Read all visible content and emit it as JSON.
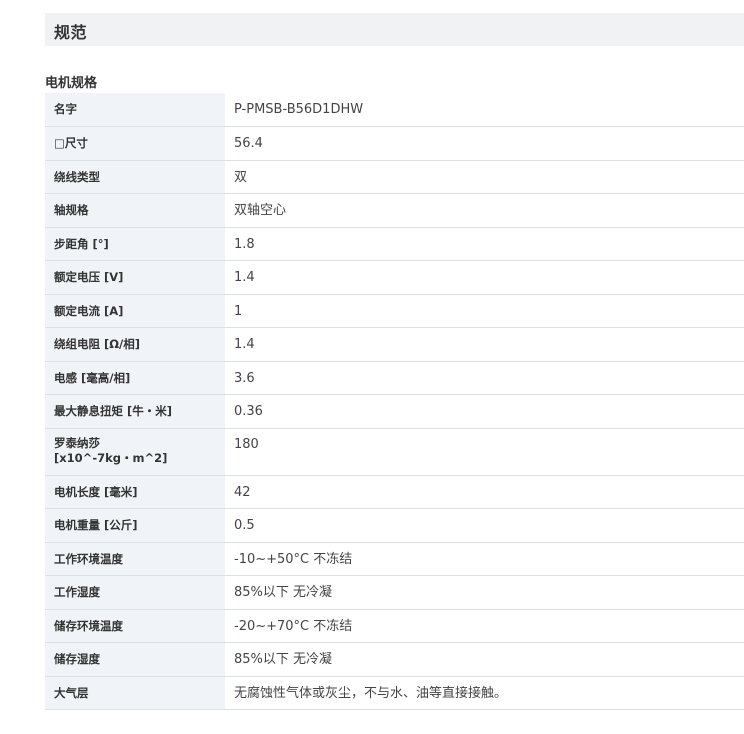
{
  "section": {
    "title": "规范"
  },
  "subsection": {
    "title": "电机规格"
  },
  "specs": [
    {
      "label": "名字",
      "value": "P-PMSB-B56D1DHW"
    },
    {
      "label": "□尺寸",
      "value": "56.4"
    },
    {
      "label": "绕线类型",
      "value": "双"
    },
    {
      "label": "轴规格",
      "value": "双轴空心"
    },
    {
      "label": "步距角 [°]",
      "value": "1.8"
    },
    {
      "label": "额定电压 [V]",
      "value": "1.4"
    },
    {
      "label": "额定电流 [A]",
      "value": "1"
    },
    {
      "label": "绕组电阻 [Ω/相]",
      "value": "1.4"
    },
    {
      "label": "电感 [毫高/相]",
      "value": "3.6"
    },
    {
      "label": "最大静息扭矩 [牛・米]",
      "value": "0.36"
    },
    {
      "label": "罗泰纳莎\n[x10^-7kg・m^2]",
      "value": "180"
    },
    {
      "label": "电机长度 [毫米]",
      "value": "42"
    },
    {
      "label": "电机重量 [公斤]",
      "value": "0.5"
    },
    {
      "label": "工作环境温度",
      "value": "-10~+50°C 不冻结"
    },
    {
      "label": "工作湿度",
      "value": "85%以下 无冷凝"
    },
    {
      "label": "储存环境温度",
      "value": "-20~+70°C 不冻结"
    },
    {
      "label": "储存湿度",
      "value": "85%以下 无冷凝"
    },
    {
      "label": "大气层",
      "value": "无腐蚀性气体或灰尘，不与水、油等直接接触。"
    }
  ]
}
